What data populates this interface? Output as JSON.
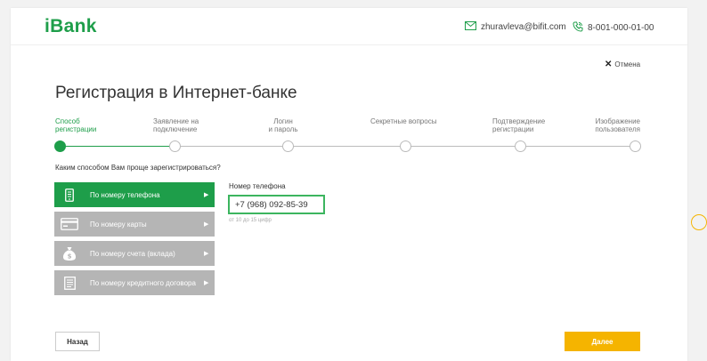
{
  "brand": {
    "logo": "iBank",
    "accent": "#1e9e4a",
    "cta_color": "#f5b400"
  },
  "header": {
    "email": "zhuravleva@bifit.com",
    "email_icon": "mail-icon",
    "phone": "8-001-000-01-00",
    "phone_icon": "phone-icon"
  },
  "cancel": {
    "label": "Отмена",
    "icon": "close-icon"
  },
  "page": {
    "title": "Регистрация в Интернет-банке"
  },
  "steps": [
    {
      "line1": "Способ",
      "line2": "регистрации",
      "active": true
    },
    {
      "line1": "Заявление на",
      "line2": "подключение",
      "active": false
    },
    {
      "line1": "Логин",
      "line2": "и пароль",
      "active": false
    },
    {
      "line1": "Секретные вопросы",
      "line2": "",
      "active": false
    },
    {
      "line1": "Подтверждение",
      "line2": "регистрации",
      "active": false
    },
    {
      "line1": "Изображение",
      "line2": "пользователя",
      "active": false
    }
  ],
  "question": "Каким способом Вам проще зарегистрироваться?",
  "methods": [
    {
      "label": "По номеру телефона",
      "icon": "phone-device-icon",
      "active": true
    },
    {
      "label": "По номеру карты",
      "icon": "card-icon",
      "active": false
    },
    {
      "label": "По номеру счета (вклада)",
      "icon": "money-bag-icon",
      "active": false
    },
    {
      "label": "По номеру кредитного договора",
      "icon": "document-icon",
      "active": false
    }
  ],
  "field": {
    "label": "Номер телефона",
    "value": "+7 (968) 092-85-39",
    "hint": "от 10 до 15 цифр"
  },
  "footer": {
    "back_label": "Назад",
    "next_label": "Далее"
  }
}
